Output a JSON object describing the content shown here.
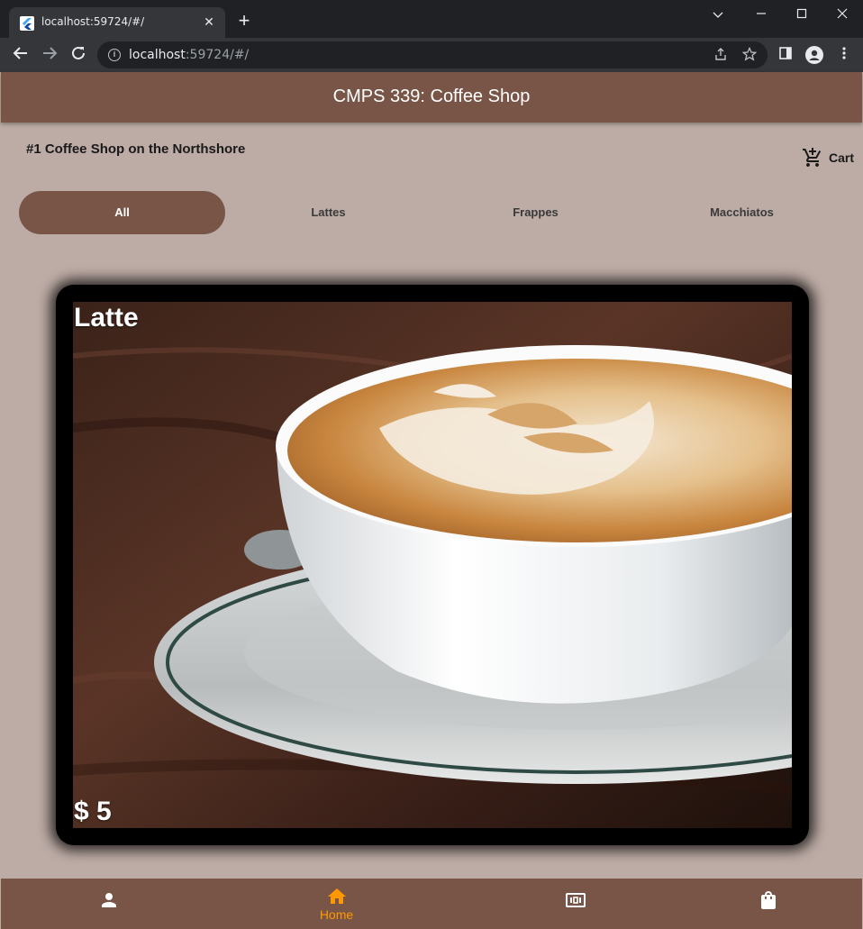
{
  "browser": {
    "tab_title": "localhost:59724/#/",
    "tab_close": "✕",
    "new_tab": "+",
    "url_host": "localhost",
    "url_rest": ":59724/#/"
  },
  "app": {
    "title": "CMPS 339: Coffee Shop",
    "tagline": "#1 Coffee Shop on the Northshore",
    "cart_label": "Cart",
    "categories": [
      {
        "label": "All",
        "active": true
      },
      {
        "label": "Lattes",
        "active": false
      },
      {
        "label": "Frappes",
        "active": false
      },
      {
        "label": "Macchiatos",
        "active": false
      }
    ],
    "product": {
      "name": "Latte",
      "price": "$ 5"
    },
    "bottom_nav": [
      {
        "icon": "person-icon",
        "label": ""
      },
      {
        "icon": "home-icon",
        "label": "Home",
        "active": true
      },
      {
        "icon": "ticket-icon",
        "label": ""
      },
      {
        "icon": "shopping-bag-icon",
        "label": ""
      }
    ]
  },
  "colors": {
    "brand_brown": "#795548",
    "background": "#bdaba5",
    "active_nav": "#ff9800"
  }
}
